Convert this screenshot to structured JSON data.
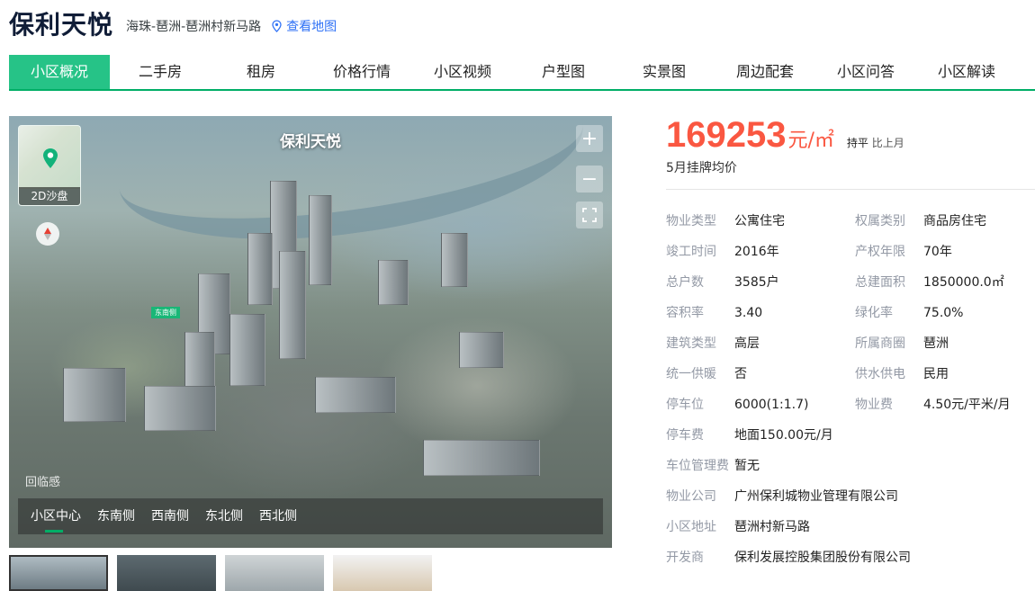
{
  "header": {
    "title": "保利天悦",
    "address": "海珠-琶洲-琶洲村新马路",
    "map_link": "查看地图"
  },
  "tabs": [
    "小区概况",
    "二手房",
    "租房",
    "价格行情",
    "小区视频",
    "户型图",
    "实景图",
    "周边配套",
    "小区问答",
    "小区解读"
  ],
  "aerial": {
    "title": "保利天悦",
    "sandbox_label": "2D沙盘",
    "zoom_in": "+",
    "zoom_out": "−",
    "watermark": "回临感",
    "view_options": [
      "小区中心",
      "东南侧",
      "西南侧",
      "东北侧",
      "西北侧"
    ],
    "building_tag": "东南侧"
  },
  "price": {
    "value": "169253",
    "unit": "元/㎡",
    "trend_flat": "持平",
    "trend_compare": "比上月",
    "label": "5月挂牌均价"
  },
  "info": [
    [
      {
        "k": "物业类型",
        "v": "公寓住宅"
      },
      {
        "k": "权属类别",
        "v": "商品房住宅"
      }
    ],
    [
      {
        "k": "竣工时间",
        "v": "2016年"
      },
      {
        "k": "产权年限",
        "v": "70年"
      }
    ],
    [
      {
        "k": "总户数",
        "v": "3585户"
      },
      {
        "k": "总建面积",
        "v": "1850000.0㎡"
      }
    ],
    [
      {
        "k": "容积率",
        "v": "3.40"
      },
      {
        "k": "绿化率",
        "v": "75.0%"
      }
    ],
    [
      {
        "k": "建筑类型",
        "v": "高层"
      },
      {
        "k": "所属商圈",
        "v": "琶洲"
      }
    ],
    [
      {
        "k": "统一供暖",
        "v": "否"
      },
      {
        "k": "供水供电",
        "v": "民用"
      }
    ],
    [
      {
        "k": "停车位",
        "v": "6000(1:1.7)"
      },
      {
        "k": "物业费",
        "v": "4.50元/平米/月"
      }
    ]
  ],
  "info_full": [
    {
      "k": "停车费",
      "v": "地面150.00元/月"
    },
    {
      "k": "车位管理费",
      "v": "暂无"
    },
    {
      "k": "物业公司",
      "v": "广州保利城物业管理有限公司"
    },
    {
      "k": "小区地址",
      "v": "琶洲村新马路"
    },
    {
      "k": "开发商",
      "v": "保利发展控股集团股份有限公司"
    }
  ],
  "colors": {
    "accent": "#00ae66",
    "tab_active": "#26c387",
    "price": "#fa5741",
    "link": "#3072f6"
  }
}
